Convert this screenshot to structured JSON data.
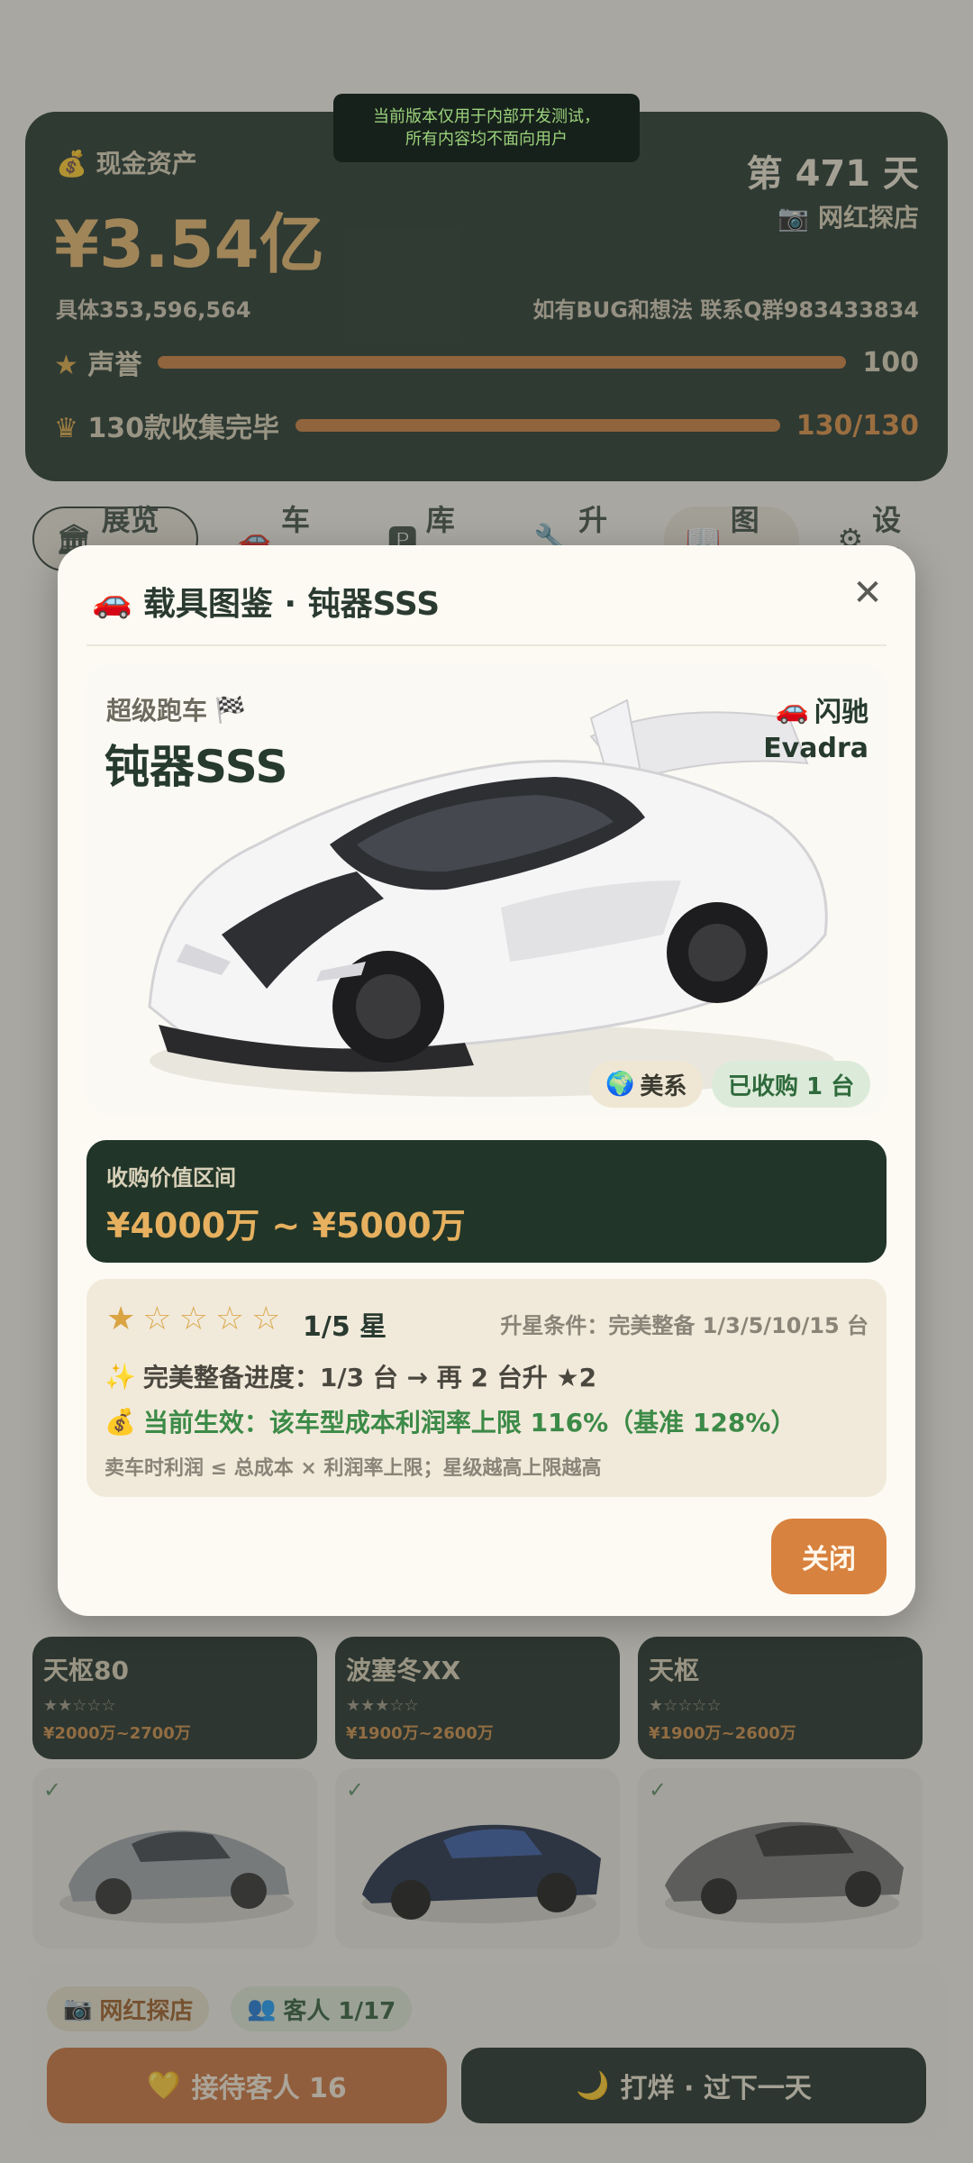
{
  "dev_banner": {
    "line1": "当前版本仅用于内部开发测试，",
    "line2": "所有内容均不面向用户"
  },
  "stats": {
    "cash_label": "现金资产",
    "cash_value": "¥3.54亿",
    "cash_exact": "具体353,596,564",
    "day": "第 471 天",
    "shop_type": "网红探店",
    "qq_note": "如有BUG和想法 联系Q群983433834",
    "reputation_label": "声誉",
    "reputation_value": "100",
    "reputation_fill": 1.0,
    "collection_label": "130款收集完毕",
    "collection_value": "130/130",
    "collection_fill": 1.0
  },
  "tabs": [
    {
      "label": "展览馆",
      "icon": "museum-icon"
    },
    {
      "label": "车源",
      "icon": "car-icon"
    },
    {
      "label": "库存",
      "icon": "parking-icon"
    },
    {
      "label": "升级",
      "icon": "wrench-icon"
    },
    {
      "label": "图鉴",
      "icon": "book-icon"
    },
    {
      "label": "设置",
      "icon": "gear-icon"
    }
  ],
  "bg_cards": [
    {
      "name": "天枢80",
      "stars": "★★☆☆☆",
      "price": "¥2000万~2700万"
    },
    {
      "name": "波塞冬XX",
      "stars": "★★★☆☆",
      "price": "¥1900万~2600万"
    },
    {
      "name": "天枢",
      "stars": "★☆☆☆☆",
      "price": "¥1900万~2600万"
    }
  ],
  "bottom": {
    "shop_pill": "网红探店",
    "guest_pill": "客人 1/17",
    "receive_button": "接待客人 16",
    "close_day_button": "打烊 · 过下一天"
  },
  "modal": {
    "title": "载具图鉴 · 钝器SSS",
    "class_label": "超级跑车",
    "car_name": "钝器SSS",
    "brand_cn": "闪驰",
    "brand_en": "Evadra",
    "origin_tag": "美系",
    "owned_tag": "已收购 1 台",
    "value_label": "收购价值区间",
    "value_range": "¥4000万 ~ ¥5000万",
    "stars_filled": 1,
    "stars_total": 5,
    "star_text": "1/5 星",
    "upgrade_condition": "升星条件：完美整备 1/3/5/10/15 台",
    "progress_text": "完美整备进度：1/3 台 → 再 2 台升 ★2",
    "effect_text": "当前生效：该车型成本利润率上限 116%（基准 128%）",
    "rule_text": "卖车时利润 ≤ 总成本 × 利润率上限；星级越高上限越高",
    "close_button": "关闭"
  },
  "colors": {
    "dark_green": "#1f3328",
    "accent_orange": "#d8823f",
    "gold": "#e6b05f",
    "success_green": "#3c8a47"
  }
}
